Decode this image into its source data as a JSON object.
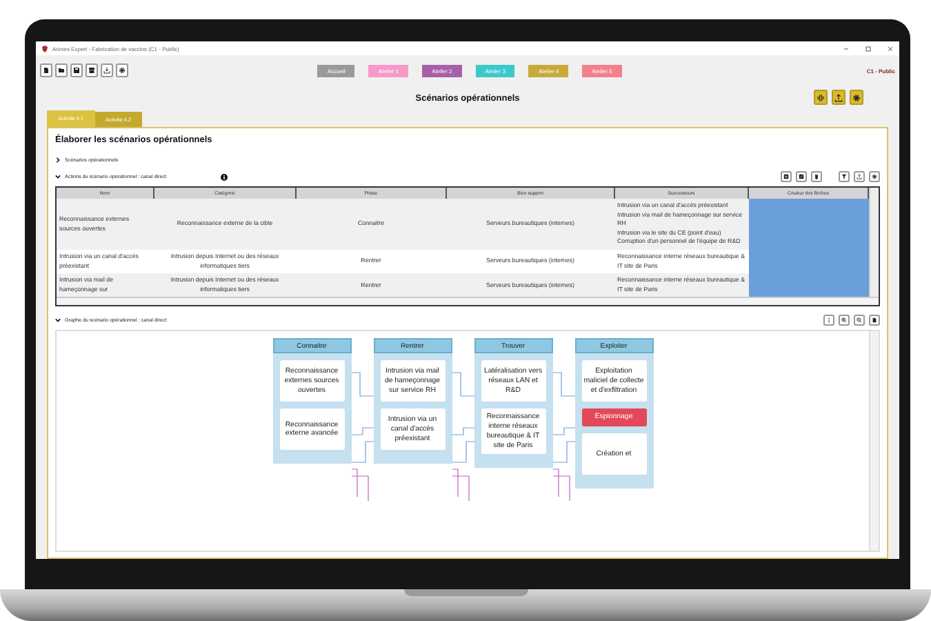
{
  "window": {
    "title": "Arimes Expert - Fabrication de vaccins (C1 - Public)"
  },
  "toolbar": {
    "ateliers": [
      {
        "label": "Accueil",
        "color": "#9a9a9a"
      },
      {
        "label": "Atelier 1",
        "color": "#f59ac8"
      },
      {
        "label": "Atelier 2",
        "color": "#a760a8"
      },
      {
        "label": "Atelier 3",
        "color": "#3cc9cc"
      },
      {
        "label": "Atelier 4",
        "color": "#c8aa3a"
      },
      {
        "label": "Atelier 5",
        "color": "#f2808c"
      }
    ],
    "classification": "C1 - Public"
  },
  "page_title": "Scénarios opérationnels",
  "tabs": [
    {
      "label": "Activité 4.1",
      "selected": true
    },
    {
      "label": "Activité 4.2",
      "selected": false
    }
  ],
  "panel": {
    "heading": "Élaborer les scénarios opérationnels",
    "scenarios_section": {
      "label": "Scénarios opérationnels",
      "expanded": false
    },
    "actions_section": {
      "label": "Actions du scénario opérationnel : canal direct",
      "expanded": true
    },
    "table": {
      "columns": [
        "Nom",
        "Catégorie",
        "Phase",
        "Bien support",
        "Successeurs",
        "Couleur des flèches"
      ],
      "rows": [
        {
          "cells": [
            "Reconnaissance externes sources ouvertes",
            "Reconnaissance externe de la cible",
            "Connaitre",
            "Serveurs bureautiques (internes)"
          ],
          "successors": [
            "Intrusion via un canal d'accès préexistant",
            "Intrusion via mail de hameçonnage sur service RH",
            "Intrusion via le site du CE (point d'eau)",
            "Corruption d'un personnel de l'équipe de R&D"
          ],
          "color": "#6a9fdc"
        },
        {
          "cells": [
            "Intrusion via un canal d'accès préexistant",
            "Intrusion depuis Internet ou des réseaux informatiques tiers",
            "Rentrer",
            "Serveurs bureautiques (internes)"
          ],
          "successors": [
            "Reconnaissance interne réseaux bureautique & IT site de Paris"
          ],
          "color": "#6a9fdc"
        },
        {
          "cells": [
            "Intrusion via mail de hameçonnage sur",
            "Intrusion depuis Internet ou des réseaux informatiques tiers",
            "Rentrer",
            "Serveurs bureautiques (internes)"
          ],
          "successors": [
            "Reconnaissance interne réseaux bureautique & IT site de Paris"
          ],
          "color": "#6a9fdc"
        }
      ]
    },
    "graph_section": {
      "label": "Graphe du scénario opérationnel : canal direct",
      "expanded": true
    },
    "graph": {
      "columns": [
        {
          "title": "Connaitre",
          "nodes": [
            {
              "label": "Reconnaissance externes sources ouvertes",
              "highlighted": false
            },
            {
              "label": "Reconnaissance externe avancée",
              "highlighted": false
            }
          ]
        },
        {
          "title": "Rentrer",
          "nodes": [
            {
              "label": "Intrusion via mail de hameçonnage sur service RH",
              "highlighted": false
            },
            {
              "label": "Intrusion via un canal d'accès préexistant",
              "highlighted": false
            }
          ]
        },
        {
          "title": "Trouver",
          "nodes": [
            {
              "label": "Latéralisation vers réseaux LAN et R&D",
              "highlighted": false
            },
            {
              "label": "Reconnaissance interne réseaux bureautique & IT site de Paris",
              "highlighted": false
            }
          ]
        },
        {
          "title": "Exploiter",
          "nodes": [
            {
              "label": "Exploitation maliciel de collecte et d'exfiltration",
              "highlighted": false
            },
            {
              "label": "Espionnage",
              "highlighted": true
            },
            {
              "label": "Création et",
              "highlighted": false
            }
          ]
        }
      ]
    }
  }
}
